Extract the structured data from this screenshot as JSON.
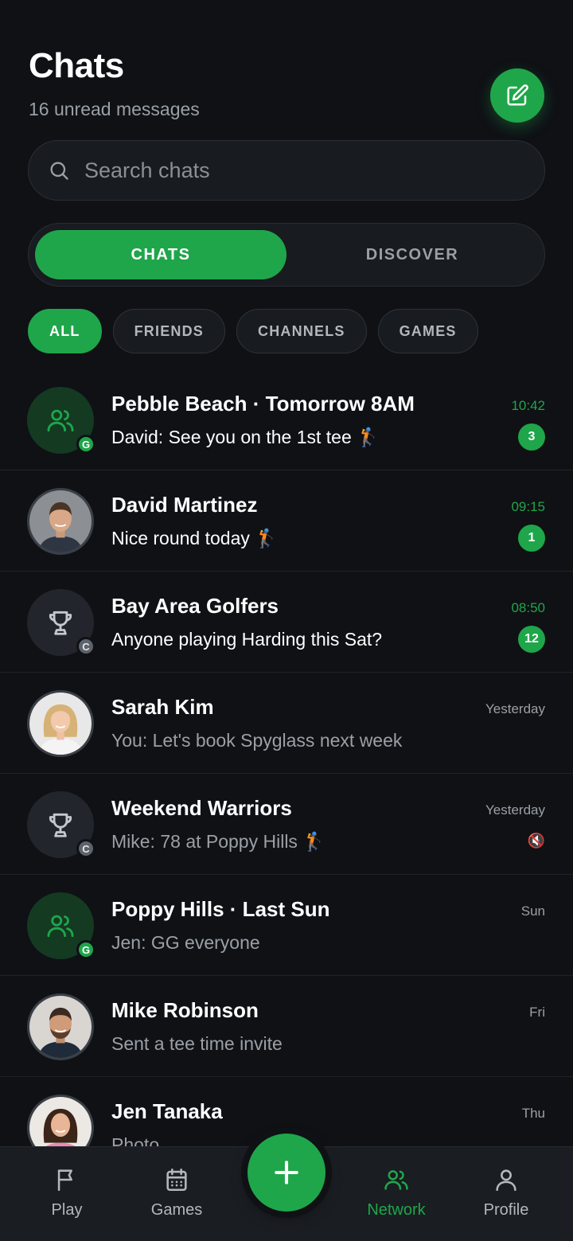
{
  "header": {
    "title": "Chats",
    "subtitle": "16 unread messages"
  },
  "search": {
    "placeholder": "Search chats"
  },
  "segments": {
    "active": "CHATS",
    "inactive": "DISCOVER"
  },
  "filters": [
    "ALL",
    "FRIENDS",
    "CHANNELS",
    "GAMES"
  ],
  "chats": [
    {
      "name": "Pebble Beach · Tomorrow 8AM",
      "preview": "David: See you on the 1st tee 🏌",
      "time": "10:42",
      "unread": "3",
      "type": "group",
      "badge": "G"
    },
    {
      "name": "David Martinez",
      "preview": "Nice round today 🏌",
      "time": "09:15",
      "unread": "1",
      "type": "photo"
    },
    {
      "name": "Bay Area Golfers",
      "preview": "Anyone playing Harding this Sat?",
      "time": "08:50",
      "unread": "12",
      "type": "channel",
      "badge": "C"
    },
    {
      "name": "Sarah Kim",
      "preview": "You: Let's book Spyglass next week",
      "time": "Yesterday",
      "type": "photo"
    },
    {
      "name": "Weekend Warriors",
      "preview": "Mike: 78 at Poppy Hills 🏌",
      "time": "Yesterday",
      "icon": "🔇",
      "type": "channel",
      "badge": "C"
    },
    {
      "name": "Poppy Hills · Last Sun",
      "preview": "Jen: GG everyone",
      "time": "Sun",
      "type": "group",
      "badge": "G"
    },
    {
      "name": "Mike Robinson",
      "preview": "Sent a tee time invite",
      "time": "Fri",
      "type": "photo"
    },
    {
      "name": "Jen Tanaka",
      "preview": "Photo",
      "time": "Thu",
      "type": "photo"
    }
  ],
  "nav": {
    "play": "Play",
    "games": "Games",
    "network": "Network",
    "profile": "Profile"
  },
  "colors": {
    "accent": "#1fa64a",
    "background": "#0f1115"
  }
}
